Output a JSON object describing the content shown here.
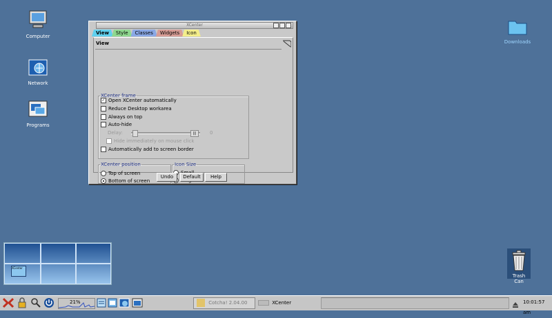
{
  "desktop": {
    "icons": [
      {
        "label": "Computer"
      },
      {
        "label": "Network"
      },
      {
        "label": "Programs"
      },
      {
        "label": "Downloads"
      },
      {
        "label": "Trash Can"
      }
    ]
  },
  "window": {
    "title": "XCenter",
    "tabs": [
      {
        "label": "View",
        "color": "#5fd0ee"
      },
      {
        "label": "Style",
        "color": "#8fd98f"
      },
      {
        "label": "Classes",
        "color": "#8aa8e6"
      },
      {
        "label": "Widgets",
        "color": "#d79c95"
      },
      {
        "label": "Icon",
        "color": "#f4ee8a"
      }
    ],
    "page_title": "View",
    "frame": {
      "legend": "XCenter frame",
      "open_auto": "Open XCenter automatically",
      "reduce": "Reduce Desktop workarea",
      "on_top": "Always on top",
      "autohide": "Auto-hide",
      "delay_label": "Delay:",
      "delay_value": "0",
      "hide_click": "Hide immediately on mouse click",
      "add_border": "Automatically add to screen border"
    },
    "position": {
      "legend": "XCenter position",
      "top": "Top of screen",
      "bottom": "Bottom of screen"
    },
    "iconsize": {
      "legend": "Icon Size",
      "small": "Small",
      "large": "Large"
    },
    "buttons": {
      "undo": "Undo",
      "default": "Default",
      "help": "Help"
    }
  },
  "taskbar": {
    "cpu": "21%",
    "tasks": [
      {
        "label": "Cotcha! 2.04.00"
      },
      {
        "label": "XCenter"
      }
    ],
    "clock": "10:01:57 am"
  },
  "pager": {
    "window_label": "XCenter"
  }
}
